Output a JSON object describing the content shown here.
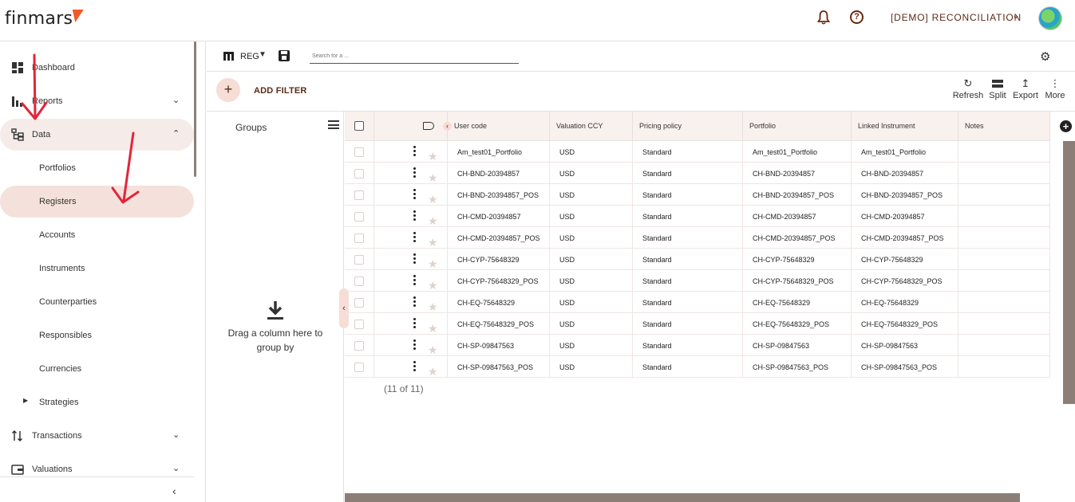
{
  "header": {
    "logo_text": "finmars",
    "workspace": "[DEMO] RECONCILIATION"
  },
  "sidebar": {
    "items": [
      {
        "label": "Dashboard",
        "icon": "dashboard-icon"
      },
      {
        "label": "Reports",
        "icon": "bar-chart-icon"
      },
      {
        "label": "Data",
        "icon": "data-tree-icon"
      },
      {
        "label": "Portfolios"
      },
      {
        "label": "Registers"
      },
      {
        "label": "Accounts"
      },
      {
        "label": "Instruments"
      },
      {
        "label": "Counterparties"
      },
      {
        "label": "Responsibles"
      },
      {
        "label": "Currencies"
      },
      {
        "label": "Strategies"
      },
      {
        "label": "Transactions",
        "icon": "transactions-icon"
      },
      {
        "label": "Valuations",
        "icon": "wallet-icon"
      }
    ]
  },
  "toolbar": {
    "view_label": "REG",
    "search_placeholder": "Search for a ...",
    "add_filter": "ADD FILTER",
    "refresh": "Refresh",
    "split": "Split",
    "export": "Export",
    "more": "More"
  },
  "groups": {
    "title": "Groups",
    "drop_hint": "Drag a column here to group by"
  },
  "table": {
    "columns": [
      "User code",
      "Valuation CCY",
      "Pricing policy",
      "Portfolio",
      "Linked Instrument",
      "Notes"
    ],
    "rows": [
      {
        "user_code": "Am_test01_Portfolio",
        "ccy": "USD",
        "pricing": "Standard",
        "portfolio": "Am_test01_Portfolio",
        "instrument": "Am_test01_Portfolio",
        "notes": ""
      },
      {
        "user_code": "CH-BND-20394857",
        "ccy": "USD",
        "pricing": "Standard",
        "portfolio": "CH-BND-20394857",
        "instrument": "CH-BND-20394857",
        "notes": ""
      },
      {
        "user_code": "CH-BND-20394857_POS",
        "ccy": "USD",
        "pricing": "Standard",
        "portfolio": "CH-BND-20394857_POS",
        "instrument": "CH-BND-20394857_POS",
        "notes": ""
      },
      {
        "user_code": "CH-CMD-20394857",
        "ccy": "USD",
        "pricing": "Standard",
        "portfolio": "CH-CMD-20394857",
        "instrument": "CH-CMD-20394857",
        "notes": ""
      },
      {
        "user_code": "CH-CMD-20394857_POS",
        "ccy": "USD",
        "pricing": "Standard",
        "portfolio": "CH-CMD-20394857_POS",
        "instrument": "CH-CMD-20394857_POS",
        "notes": ""
      },
      {
        "user_code": "CH-CYP-75648329",
        "ccy": "USD",
        "pricing": "Standard",
        "portfolio": "CH-CYP-75648329",
        "instrument": "CH-CYP-75648329",
        "notes": ""
      },
      {
        "user_code": "CH-CYP-75648329_POS",
        "ccy": "USD",
        "pricing": "Standard",
        "portfolio": "CH-CYP-75648329_POS",
        "instrument": "CH-CYP-75648329_POS",
        "notes": ""
      },
      {
        "user_code": "CH-EQ-75648329",
        "ccy": "USD",
        "pricing": "Standard",
        "portfolio": "CH-EQ-75648329",
        "instrument": "CH-EQ-75648329",
        "notes": ""
      },
      {
        "user_code": "CH-EQ-75648329_POS",
        "ccy": "USD",
        "pricing": "Standard",
        "portfolio": "CH-EQ-75648329_POS",
        "instrument": "CH-EQ-75648329_POS",
        "notes": ""
      },
      {
        "user_code": "CH-SP-09847563",
        "ccy": "USD",
        "pricing": "Standard",
        "portfolio": "CH-SP-09847563",
        "instrument": "CH-SP-09847563",
        "notes": ""
      },
      {
        "user_code": "CH-SP-09847563_POS",
        "ccy": "USD",
        "pricing": "Standard",
        "portfolio": "CH-SP-09847563_POS",
        "instrument": "CH-SP-09847563_POS",
        "notes": ""
      }
    ],
    "count": "(11 of 11)"
  },
  "colors": {
    "accent": "#f05a28",
    "arrow": "#e3253a",
    "selected_bg": "#f5e1db"
  }
}
